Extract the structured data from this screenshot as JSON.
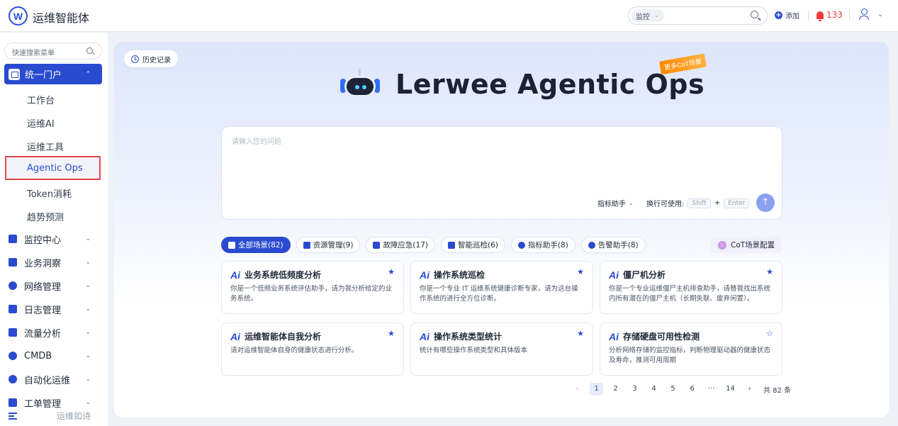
{
  "header": {
    "app_title": "运维智能体",
    "logo_letter": "W",
    "search_select": "监控",
    "add_label": "添加",
    "alert_count": "133"
  },
  "sidebar": {
    "search_placeholder": "快速搜索菜单",
    "active_group": "统一门户",
    "sub_items": [
      "工作台",
      "运维AI",
      "运维工具",
      "Agentic Ops",
      "Token消耗",
      "趋势预测"
    ],
    "groups": [
      "监控中心",
      "业务洞察",
      "网络管理",
      "日志管理",
      "流量分析",
      "CMDB",
      "自动化运维",
      "工单管理"
    ],
    "footer_text": "运维如诗"
  },
  "main": {
    "history_label": "历史记录",
    "hero_title": "Lerwee Agentic Ops",
    "cot_tag": "更多CoT场景",
    "input_placeholder": "请输入您的问题",
    "assistant_select": "指标助手",
    "newline_hint": "换行可使用:",
    "key_shift": "Shift",
    "key_plus": "+",
    "key_enter": "Enter",
    "tabs": [
      {
        "label": "全部场景(82)"
      },
      {
        "label": "资源管理(9)"
      },
      {
        "label": "故障应急(17)"
      },
      {
        "label": "智能巡检(6)"
      },
      {
        "label": "指标助手(8)"
      },
      {
        "label": "告警助手(8)"
      }
    ],
    "cot_button": "CoT场景配置",
    "cards": [
      {
        "title": "业务系统低频度分析",
        "desc": "你是一个低频业务系统评估助手，请为我分析给定的业务系统。",
        "starred": true
      },
      {
        "title": "操作系统巡检",
        "desc": "你是一个专业 IT 运维系统健康诊断专家，请为这台操作系统的进行全方位诊断。",
        "starred": true
      },
      {
        "title": "僵尸机分析",
        "desc": "你是一个专业运维僵尸主机排查助手，请替我找出系统内所有潜在的僵尸主机（长期失联、废弃闲置）。",
        "starred": true
      },
      {
        "title": "运维智能体自我分析",
        "desc": "请对运维智能体自身的健康状态进行分析。",
        "starred": true
      },
      {
        "title": "操作系统类型统计",
        "desc": "统计有哪些操作系统类型和具体版本",
        "starred": true
      },
      {
        "title": "存储硬盘可用性检测",
        "desc": "分析网络存储的监控指标，判断物理驱动器的健康状态及寿命，推测可用周期",
        "starred": false
      }
    ],
    "pagination": {
      "pages": [
        "1",
        "2",
        "3",
        "4",
        "5",
        "6",
        "···",
        "14"
      ],
      "current": "1",
      "total": "共 82 条"
    }
  }
}
